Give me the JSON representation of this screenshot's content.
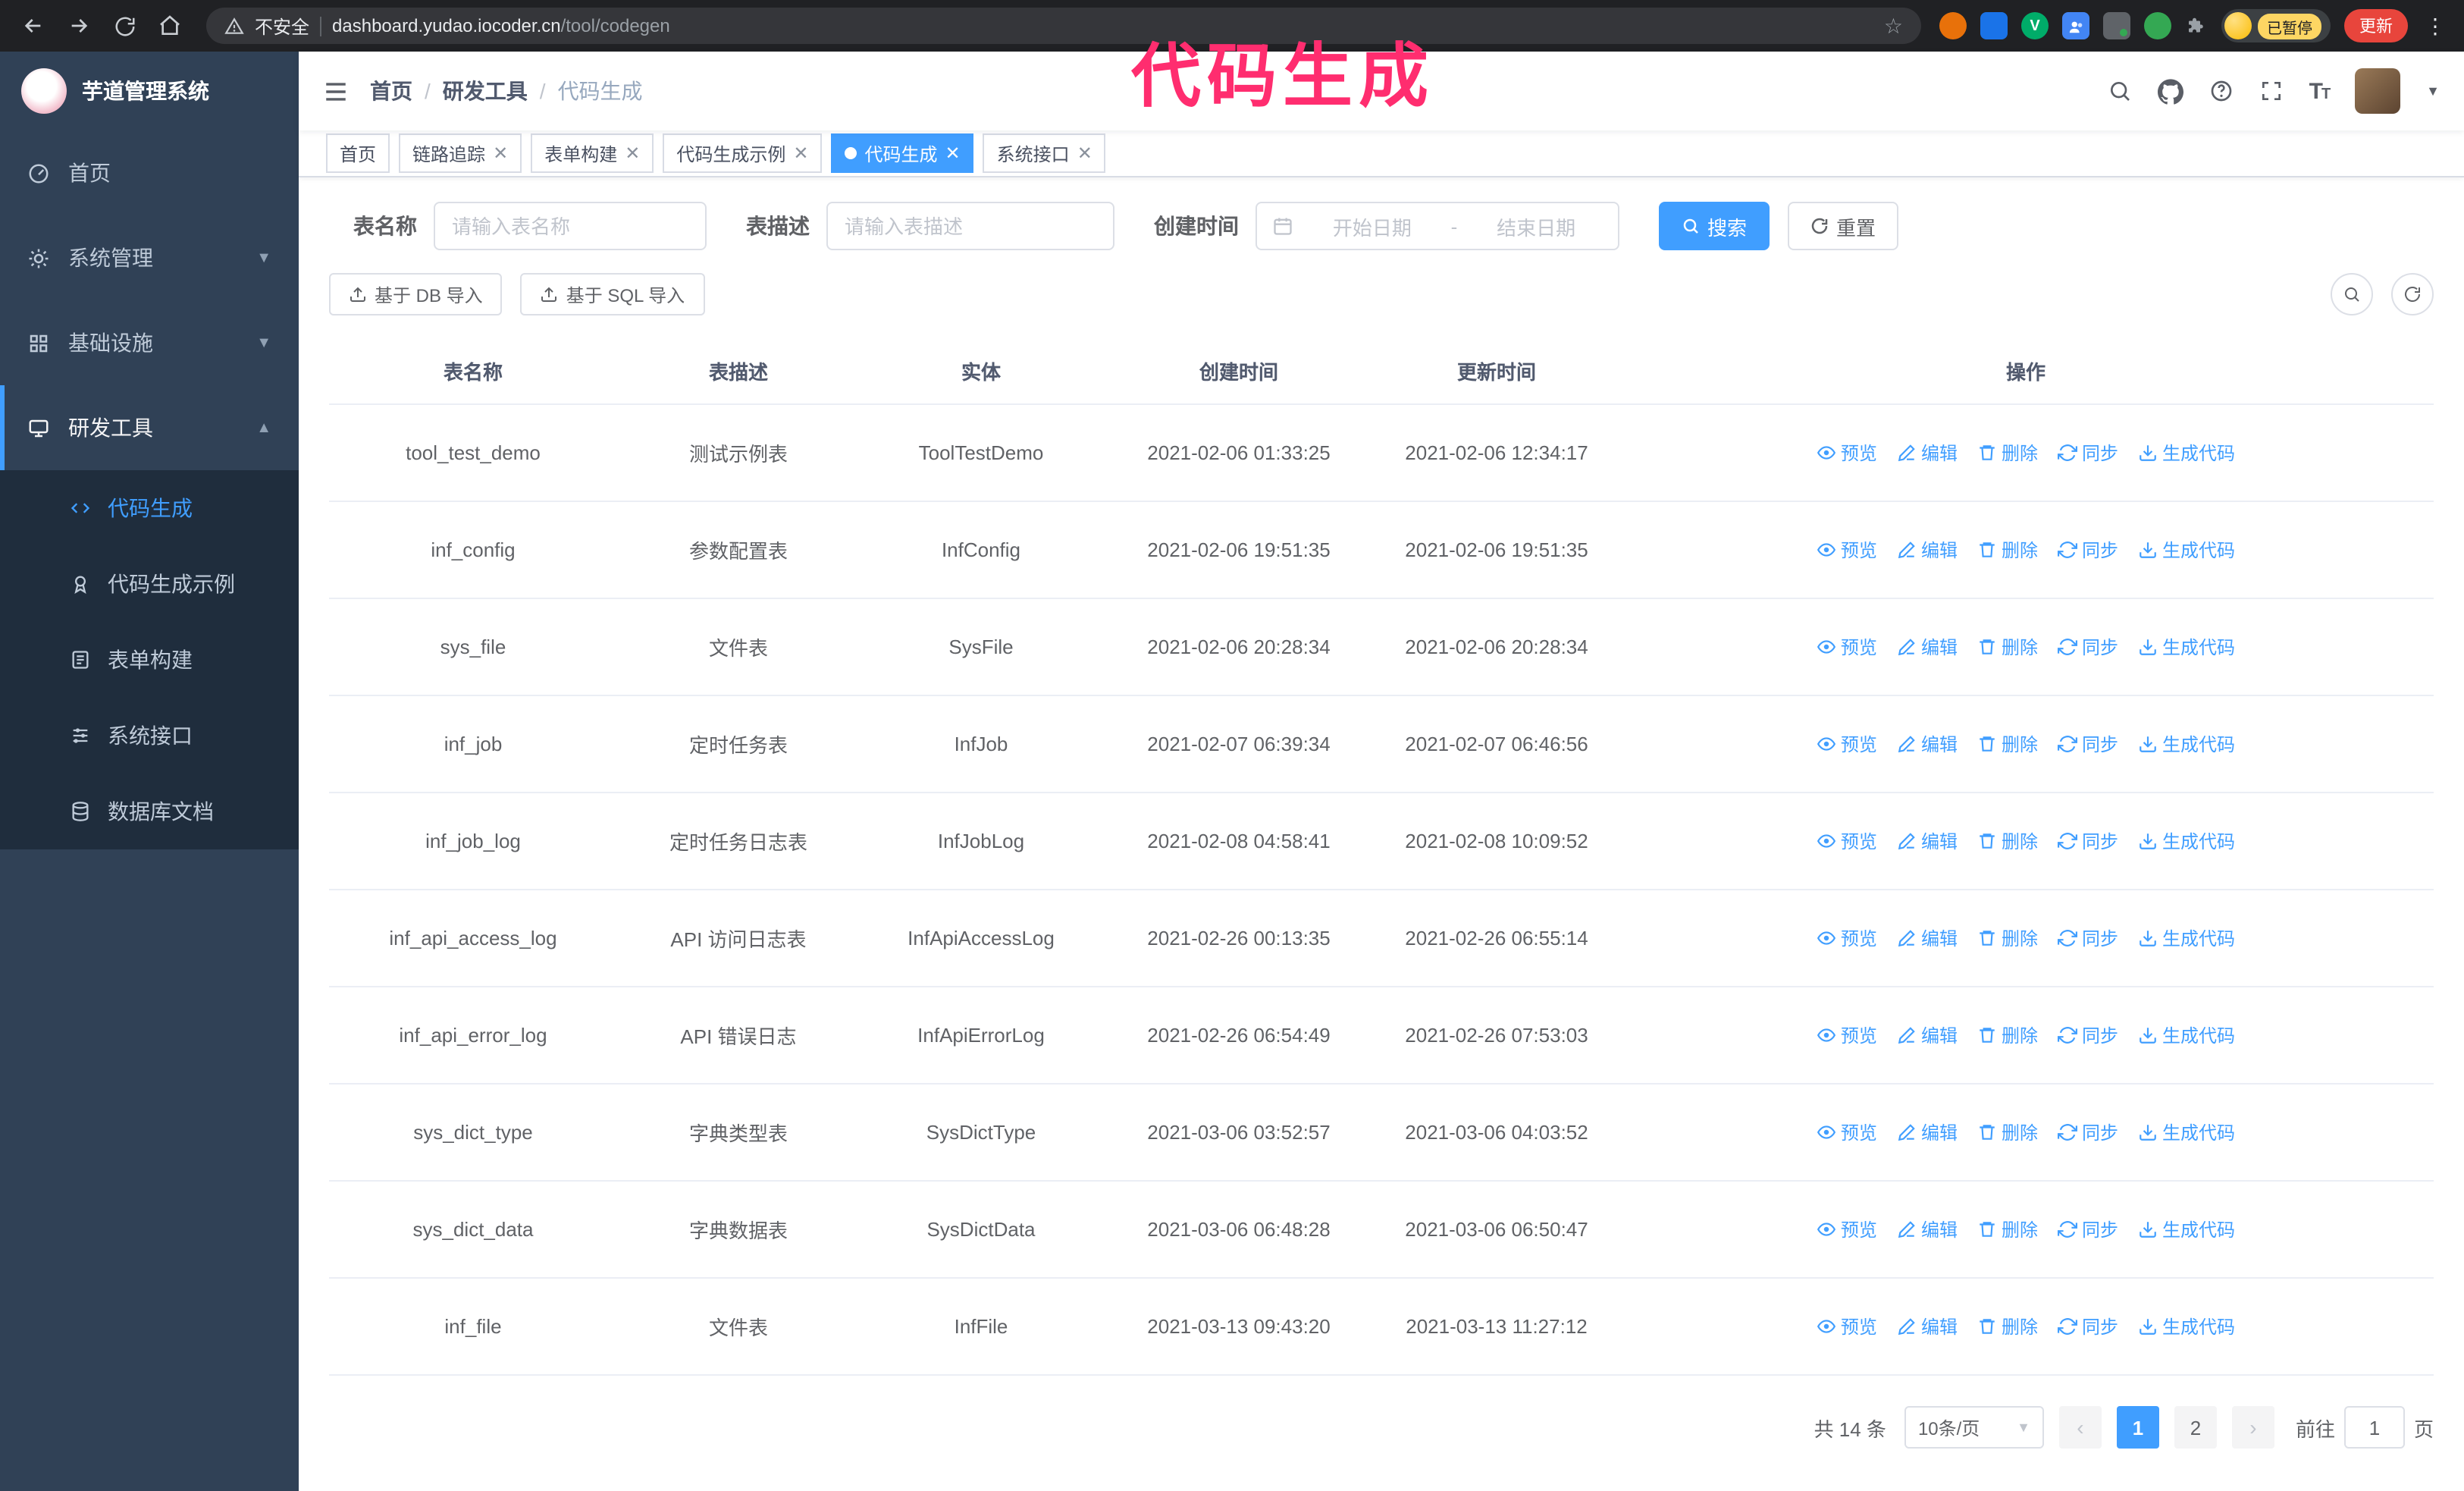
{
  "annotation": {
    "text": "代码生成"
  },
  "colors": {
    "accent": "#409eff",
    "annotation_pink": "#ff2d6f",
    "sidebar_bg": "#304156",
    "submenu_bg": "#1f2d3d",
    "active_text": "#409eff"
  },
  "browser": {
    "security_label": "不安全",
    "url_host": "dashboard.yudao.iocoder.cn",
    "url_path": "/tool/codegen",
    "profile_badge": "已暂停",
    "update_button": "更新"
  },
  "sidebar": {
    "app_title": "芋道管理系统",
    "items": [
      {
        "label": "首页"
      },
      {
        "label": "系统管理"
      },
      {
        "label": "基础设施"
      },
      {
        "label": "研发工具"
      }
    ],
    "sub_items": [
      {
        "label": "代码生成"
      },
      {
        "label": "代码生成示例"
      },
      {
        "label": "表单构建"
      },
      {
        "label": "系统接口"
      },
      {
        "label": "数据库文档"
      }
    ]
  },
  "breadcrumb": {
    "home": "首页",
    "section": "研发工具",
    "current": "代码生成",
    "separator": "/"
  },
  "tabs": [
    {
      "label": "首页"
    },
    {
      "label": "链路追踪"
    },
    {
      "label": "表单构建"
    },
    {
      "label": "代码生成示例"
    },
    {
      "label": "代码生成"
    },
    {
      "label": "系统接口"
    }
  ],
  "filters": {
    "table_name_label": "表名称",
    "table_name_placeholder": "请输入表名称",
    "table_desc_label": "表描述",
    "table_desc_placeholder": "请输入表描述",
    "create_time_label": "创建时间",
    "date_start_placeholder": "开始日期",
    "date_range_separator": "-",
    "date_end_placeholder": "结束日期",
    "search_label": "搜索",
    "reset_label": "重置"
  },
  "toolbar": {
    "import_db": "基于 DB 导入",
    "import_sql": "基于 SQL 导入"
  },
  "table": {
    "columns": [
      "表名称",
      "表描述",
      "实体",
      "创建时间",
      "更新时间",
      "操作"
    ],
    "actions": [
      "预览",
      "编辑",
      "删除",
      "同步",
      "生成代码"
    ],
    "rows": [
      {
        "name": "tool_test_demo",
        "desc": "测试示例表",
        "entity": "ToolTestDemo",
        "created": "2021-02-06 01:33:25",
        "updated": "2021-02-06 12:34:17"
      },
      {
        "name": "inf_config",
        "desc": "参数配置表",
        "entity": "InfConfig",
        "created": "2021-02-06 19:51:35",
        "updated": "2021-02-06 19:51:35"
      },
      {
        "name": "sys_file",
        "desc": "文件表",
        "entity": "SysFile",
        "created": "2021-02-06 20:28:34",
        "updated": "2021-02-06 20:28:34"
      },
      {
        "name": "inf_job",
        "desc": "定时任务表",
        "entity": "InfJob",
        "created": "2021-02-07 06:39:34",
        "updated": "2021-02-07 06:46:56"
      },
      {
        "name": "inf_job_log",
        "desc": "定时任务日志表",
        "entity": "InfJobLog",
        "created": "2021-02-08 04:58:41",
        "updated": "2021-02-08 10:09:52"
      },
      {
        "name": "inf_api_access_log",
        "desc": "API 访问日志表",
        "entity": "InfApiAccessLog",
        "created": "2021-02-26 00:13:35",
        "updated": "2021-02-26 06:55:14"
      },
      {
        "name": "inf_api_error_log",
        "desc": "API 错误日志",
        "entity": "InfApiErrorLog",
        "created": "2021-02-26 06:54:49",
        "updated": "2021-02-26 07:53:03"
      },
      {
        "name": "sys_dict_type",
        "desc": "字典类型表",
        "entity": "SysDictType",
        "created": "2021-03-06 03:52:57",
        "updated": "2021-03-06 04:03:52"
      },
      {
        "name": "sys_dict_data",
        "desc": "字典数据表",
        "entity": "SysDictData",
        "created": "2021-03-06 06:48:28",
        "updated": "2021-03-06 06:50:47"
      },
      {
        "name": "inf_file",
        "desc": "文件表",
        "entity": "InfFile",
        "created": "2021-03-13 09:43:20",
        "updated": "2021-03-13 11:27:12"
      }
    ]
  },
  "pagination": {
    "total_label": "共 14 条",
    "page_size_label": "10条/页",
    "pages": [
      "1",
      "2"
    ],
    "active_page": "1",
    "goto_prefix": "前往",
    "goto_value": "1",
    "goto_suffix": "页"
  }
}
